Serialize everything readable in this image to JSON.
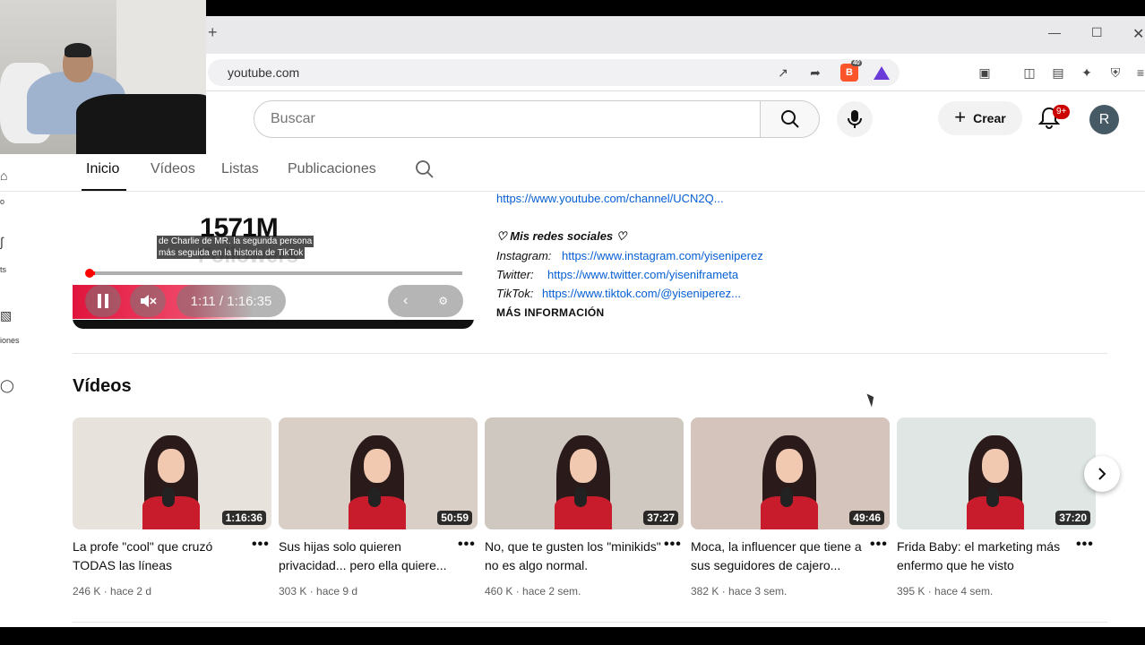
{
  "browser": {
    "url": "youtube.com",
    "new_tab": "+"
  },
  "yt_header": {
    "search_placeholder": "Buscar",
    "create_label": "Crear",
    "notifications_badge": "9+",
    "avatar_letter": "R"
  },
  "channel_tabs": [
    {
      "label": "Inicio",
      "active": true
    },
    {
      "label": "Vídeos",
      "active": false
    },
    {
      "label": "Listas",
      "active": false
    },
    {
      "label": "Publicaciones",
      "active": false
    }
  ],
  "sidebar_fragments": [
    "o",
    "ts",
    "iones"
  ],
  "featured_video": {
    "overlay_number": "1571M",
    "overlay_sub": "Followers",
    "caption_line1": "de Charlie de MR. la segunda persona",
    "caption_line2": "más seguida en la historia de TikTok",
    "time": "1:11 / 1:16:35",
    "progress_fraction": 0.015
  },
  "description": {
    "channel_link": "https://www.youtube.com/channel/UCN2Q...",
    "socials_heading": "♡ Mis redes sociales ♡",
    "instagram_label": "Instagram:",
    "instagram_link": "https://www.instagram.com/yiseniperez",
    "twitter_label": "Twitter:",
    "twitter_link": "https://www.twitter.com/yiseniframeta",
    "tiktok_label": "TikTok:",
    "tiktok_link": "https://www.tiktok.com/@yiseniperez...",
    "more_info": "MÁS INFORMACIÓN"
  },
  "videos_section": {
    "title": "Vídeos",
    "items": [
      {
        "title": "La profe \"cool\" que cruzó TODAS las líneas",
        "meta": "246 K · hace 2 d",
        "duration": "1:16:36",
        "color": "#e8e2dc"
      },
      {
        "title": "Sus hijas solo quieren privacidad... pero ella quiere...",
        "meta": "303 K · hace 9 d",
        "duration": "50:59",
        "color": "#d9cfc6"
      },
      {
        "title": "No, que te gusten los \"minikids\" no es algo normal.",
        "meta": "460 K · hace 2 sem.",
        "duration": "37:27",
        "color": "#cfc8c0"
      },
      {
        "title": "Moca, la influencer que tiene a sus seguidores de cajero...",
        "meta": "382 K · hace 3 sem.",
        "duration": "49:46",
        "color": "#d4c4bb"
      },
      {
        "title": "Frida Baby: el marketing más enfermo que he visto",
        "meta": "395 K · hace 4 sem.",
        "duration": "37:20",
        "color": "#dfe6e4"
      }
    ]
  },
  "colors": {
    "accent_red": "#ff0000",
    "link_blue": "#065fd4"
  }
}
